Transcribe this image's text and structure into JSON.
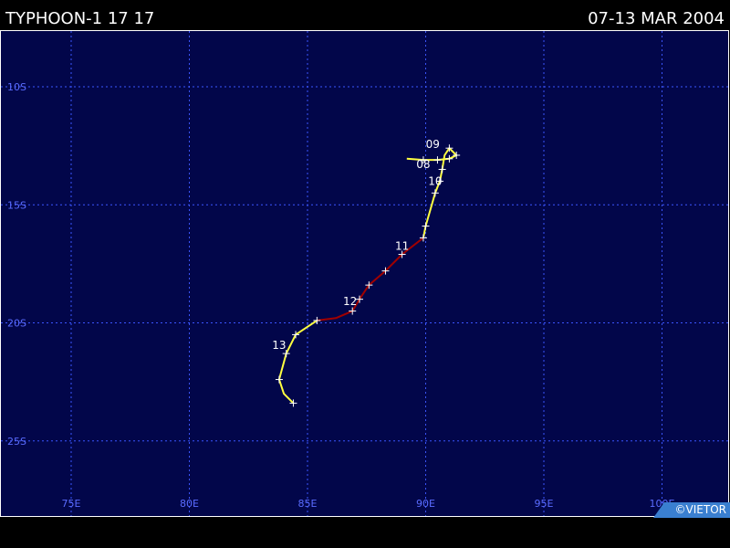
{
  "header": {
    "storm_name": "TYPHOON-1 17 17",
    "date_range": "07-13 MAR 2004"
  },
  "map": {
    "background_color": "#02064a",
    "grid_color": "#3b55ff",
    "label_color": "#5a6cff",
    "border_color": "#ffffff",
    "lat_labels": [
      "10S",
      "15S",
      "20S",
      "25S"
    ],
    "lon_labels": [
      "75E",
      "80E",
      "85E",
      "90E",
      "95E",
      "100E"
    ],
    "latitudes": [
      -10,
      -15,
      -20,
      -25
    ],
    "longitudes": [
      75,
      80,
      85,
      90,
      95,
      100
    ]
  },
  "track": {
    "colors": {
      "yellow": "#ffff40",
      "red": "#a00000",
      "marker": "#ffffff"
    },
    "segments": [
      {
        "intensity": "yellow",
        "points": [
          [
            89.2,
            -13.05
          ],
          [
            89.9,
            -13.1
          ],
          [
            90.5,
            -13.1
          ],
          [
            91.0,
            -13.05
          ],
          [
            91.3,
            -12.9
          ],
          [
            91.0,
            -12.6
          ],
          [
            90.8,
            -12.9
          ],
          [
            90.7,
            -13.5
          ],
          [
            90.6,
            -14.0
          ],
          [
            90.4,
            -14.5
          ],
          [
            90.2,
            -15.2
          ],
          [
            90.0,
            -15.9
          ],
          [
            89.9,
            -16.4
          ]
        ]
      },
      {
        "intensity": "red",
        "points": [
          [
            89.9,
            -16.4
          ],
          [
            89.0,
            -17.1
          ],
          [
            88.3,
            -17.8
          ],
          [
            87.6,
            -18.4
          ],
          [
            87.2,
            -19.0
          ],
          [
            86.9,
            -19.5
          ],
          [
            86.2,
            -19.8
          ],
          [
            85.4,
            -19.9
          ]
        ]
      },
      {
        "intensity": "yellow",
        "points": [
          [
            85.4,
            -19.9
          ],
          [
            84.5,
            -20.5
          ],
          [
            84.1,
            -21.3
          ],
          [
            83.8,
            -22.4
          ],
          [
            84.0,
            -23.0
          ],
          [
            84.4,
            -23.4
          ]
        ]
      }
    ],
    "markers": [
      [
        89.9,
        -13.1
      ],
      [
        90.5,
        -13.1
      ],
      [
        91.0,
        -13.05
      ],
      [
        91.3,
        -12.9
      ],
      [
        91.0,
        -12.6
      ],
      [
        90.7,
        -13.5
      ],
      [
        90.6,
        -14.0
      ],
      [
        90.4,
        -14.5
      ],
      [
        90.0,
        -15.9
      ],
      [
        89.9,
        -16.4
      ],
      [
        89.0,
        -17.1
      ],
      [
        88.3,
        -17.8
      ],
      [
        87.6,
        -18.4
      ],
      [
        87.2,
        -19.0
      ],
      [
        86.9,
        -19.5
      ],
      [
        85.4,
        -19.9
      ],
      [
        84.5,
        -20.5
      ],
      [
        84.1,
        -21.3
      ],
      [
        83.8,
        -22.4
      ],
      [
        84.4,
        -23.4
      ]
    ],
    "day_labels": [
      {
        "text": "09",
        "lon": 90.3,
        "lat": -12.6
      },
      {
        "text": "08",
        "lon": 89.9,
        "lat": -13.45
      },
      {
        "text": "10",
        "lon": 90.4,
        "lat": -14.15
      },
      {
        "text": "11",
        "lon": 89.0,
        "lat": -16.9
      },
      {
        "text": "12",
        "lon": 86.8,
        "lat": -19.25
      },
      {
        "text": "13",
        "lon": 83.8,
        "lat": -21.1
      }
    ]
  },
  "credit": {
    "text": "©VIETOR",
    "badge_color": "#3a7fd0"
  }
}
